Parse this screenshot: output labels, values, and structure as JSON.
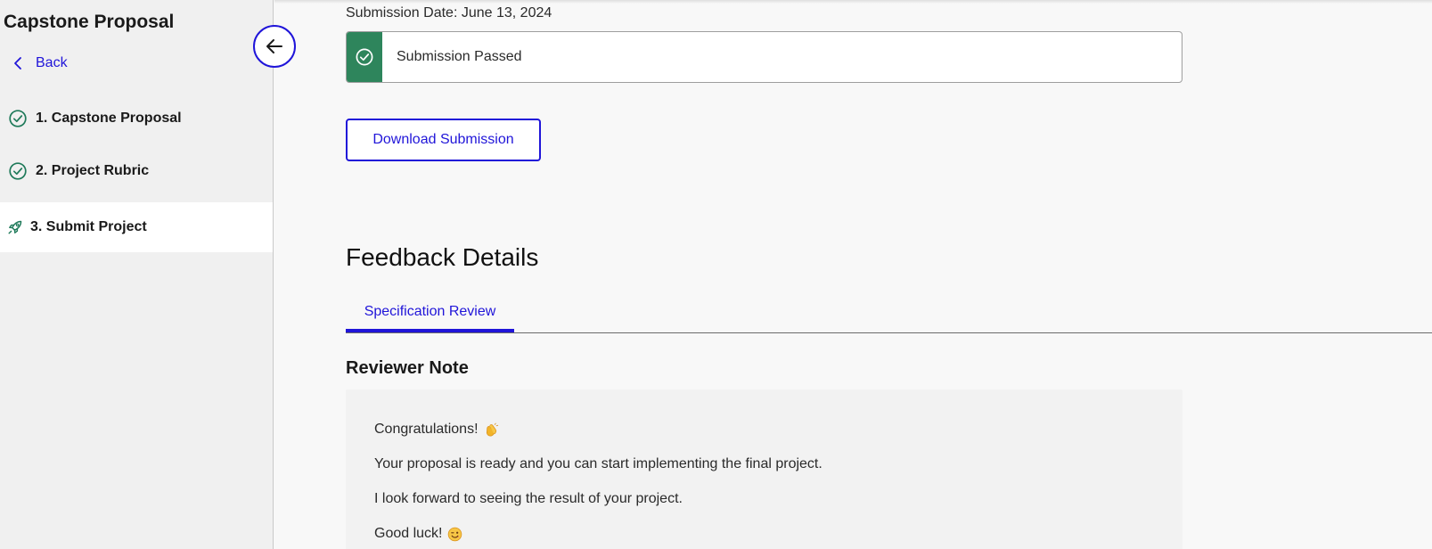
{
  "sidebar": {
    "title": "Capstone Proposal",
    "back_label": "Back",
    "items": [
      {
        "label": "1. Capstone Proposal",
        "icon": "check-circle-icon",
        "status": "complete"
      },
      {
        "label": "2. Project Rubric",
        "icon": "check-circle-icon",
        "status": "complete"
      },
      {
        "label": "3. Submit Project",
        "icon": "rocket-icon",
        "status": "active"
      }
    ]
  },
  "collapse_button": {
    "icon": "arrow-left-icon"
  },
  "submission": {
    "date_text": "Submission Date: June 13, 2024",
    "status_text": "Submission Passed",
    "status_icon": "check-circle-icon",
    "download_label": "Download Submission"
  },
  "feedback": {
    "title": "Feedback Details",
    "tabs": [
      {
        "label": "Specification Review",
        "active": true
      }
    ],
    "reviewer_note_title": "Reviewer Note",
    "note_lines": [
      {
        "text": "Congratulations!",
        "emoji": "clapping-hands-icon"
      },
      {
        "text": "Your proposal is ready and you can start implementing the final project."
      },
      {
        "text": "I look forward to seeing the result of your project."
      },
      {
        "text": "Good luck!",
        "emoji": "winking-face-icon"
      }
    ]
  },
  "colors": {
    "accent": "#2015d9",
    "success": "#2e855c",
    "nav_check": "#1f7a5a",
    "sidebar_bg": "#f0f0f0",
    "page_bg": "#f8f8f8"
  }
}
